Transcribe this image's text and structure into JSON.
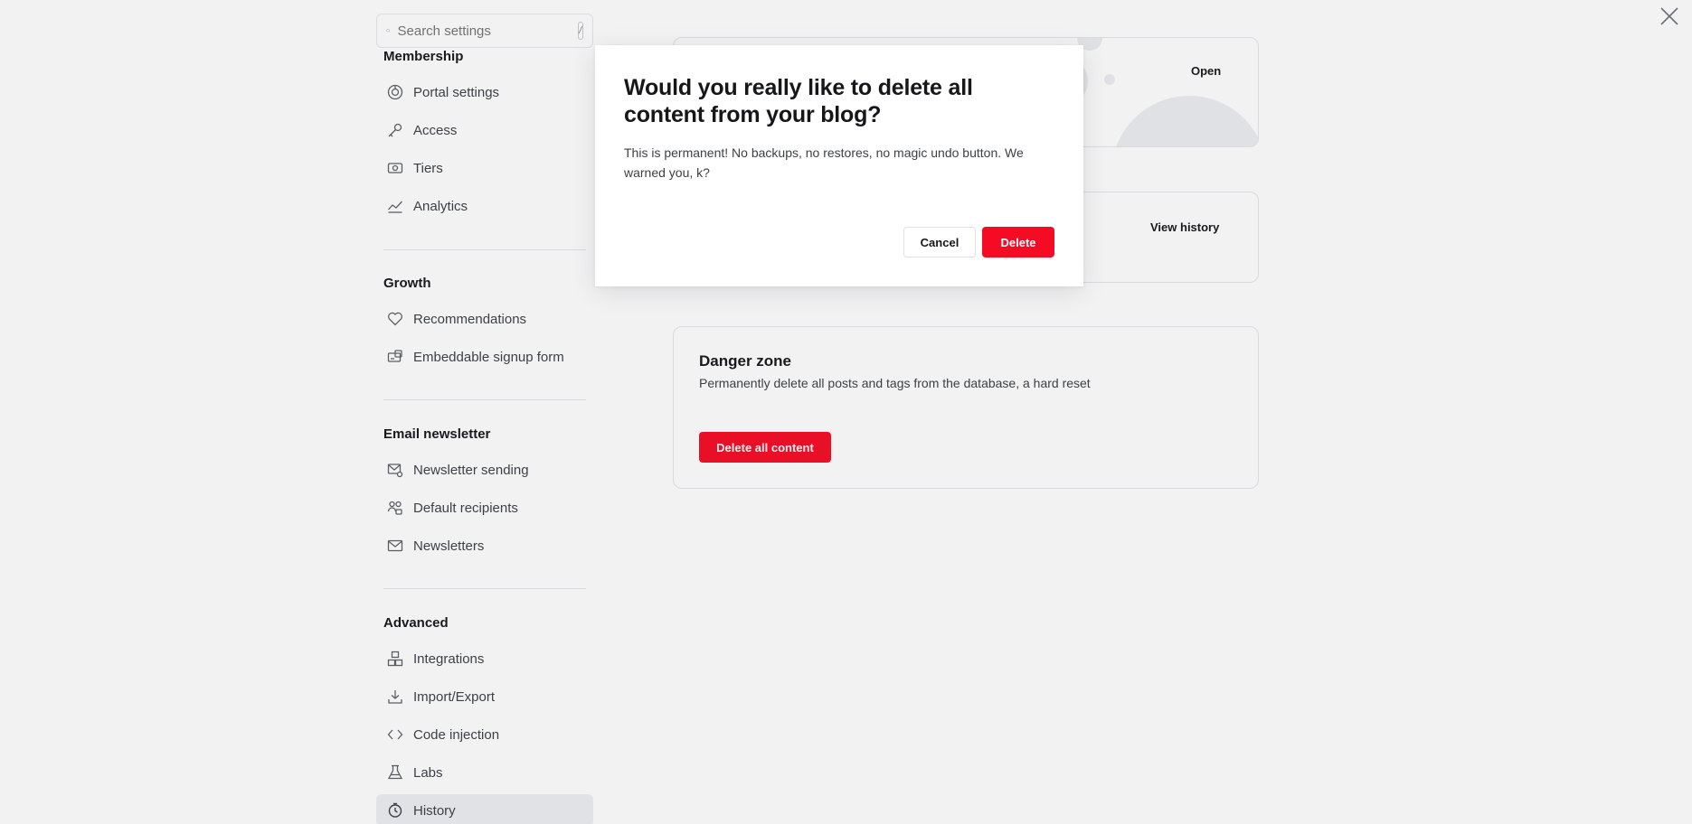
{
  "search": {
    "placeholder": "Search settings",
    "shortcut": "/"
  },
  "sidebar": {
    "membership": {
      "title": "Membership",
      "items": [
        {
          "label": "Portal settings",
          "icon": "portal-icon"
        },
        {
          "label": "Access",
          "icon": "key-icon"
        },
        {
          "label": "Tiers",
          "icon": "tiers-icon"
        },
        {
          "label": "Analytics",
          "icon": "analytics-icon"
        }
      ]
    },
    "growth": {
      "title": "Growth",
      "items": [
        {
          "label": "Recommendations",
          "icon": "heart-icon"
        },
        {
          "label": "Embeddable signup form",
          "icon": "signup-form-icon"
        }
      ]
    },
    "email": {
      "title": "Email newsletter",
      "items": [
        {
          "label": "Newsletter sending",
          "icon": "mail-settings-icon"
        },
        {
          "label": "Default recipients",
          "icon": "recipients-icon"
        },
        {
          "label": "Newsletters",
          "icon": "mail-icon"
        }
      ]
    },
    "advanced": {
      "title": "Advanced",
      "items": [
        {
          "label": "Integrations",
          "icon": "integrations-icon"
        },
        {
          "label": "Import/Export",
          "icon": "download-icon"
        },
        {
          "label": "Code injection",
          "icon": "code-icon"
        },
        {
          "label": "Labs",
          "icon": "flask-icon"
        },
        {
          "label": "History",
          "icon": "history-icon",
          "active": true
        }
      ]
    }
  },
  "main": {
    "top_card_action": "Open",
    "history_card_action": "View history",
    "danger": {
      "title": "Danger zone",
      "description": "Permanently delete all posts and tags from the database, a hard reset",
      "button": "Delete all content"
    }
  },
  "modal": {
    "title": "Would you really like to delete all content from your blog?",
    "body": "This is permanent! No backups, no restores, no magic undo button. We warned you, k?",
    "cancel": "Cancel",
    "confirm": "Delete"
  },
  "colors": {
    "danger_red": "#f50b23",
    "active_item_bg": "#eceef0",
    "text_primary": "#15171a",
    "text_secondary": "#3c4146"
  }
}
